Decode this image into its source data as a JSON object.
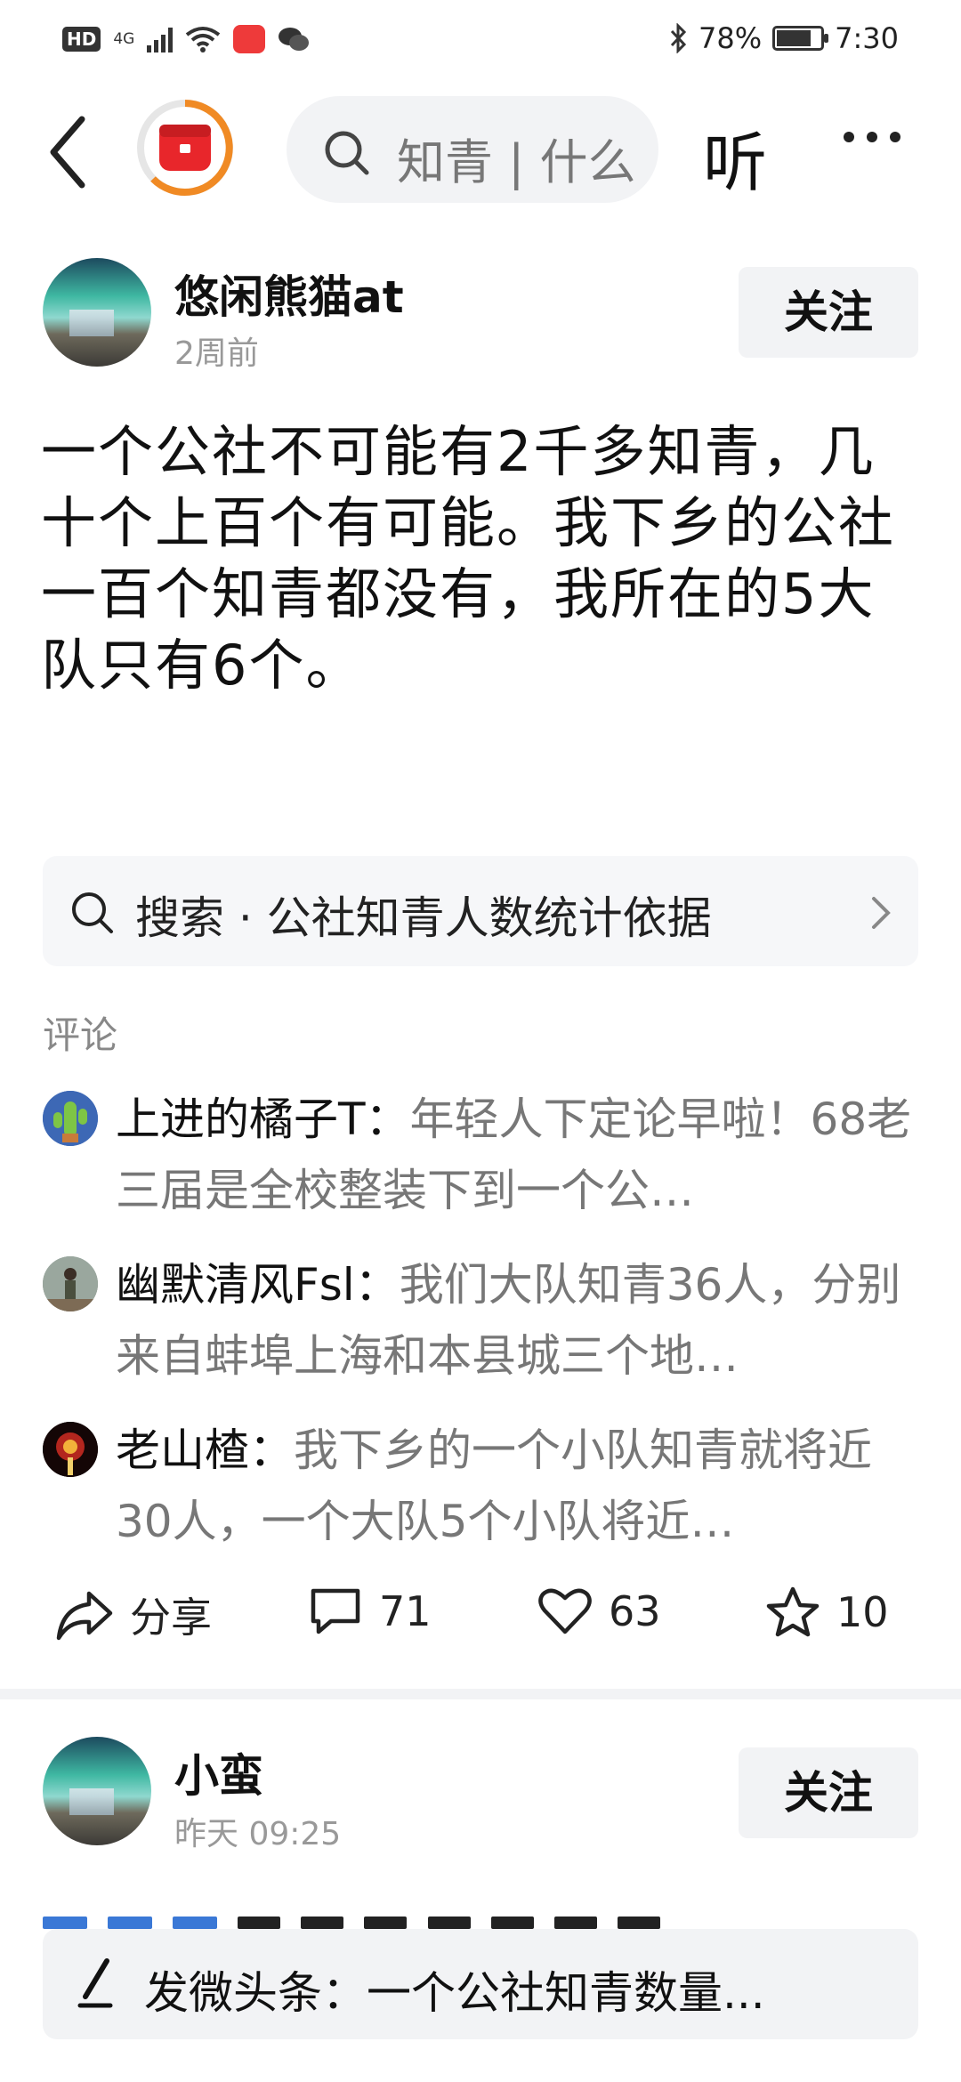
{
  "status_bar": {
    "hd": "HD",
    "network": "4G",
    "bluetooth_icon": "bluetooth-icon",
    "battery_percent": "78%",
    "battery_level": 0.78,
    "time": "7:30"
  },
  "header": {
    "search_placeholder": "知青 | 什么",
    "search_visible": "知青 | 什么",
    "listen_label": "听"
  },
  "posts": [
    {
      "author": "悠闲熊猫at",
      "time": "2周前",
      "follow_label": "关注",
      "body": "一个公社不可能有2千多知青，几十个上百个有可能。我下乡的公社一百个知青都没有，我所在的5大队只有6个。",
      "search_suggestion": "搜索 · 公社知青人数统计依据",
      "comments_title": "评论",
      "comments": [
        {
          "user": "上进的橘子T：",
          "text": "年轻人下定论早啦！68老三届是全校整装下到一个公…"
        },
        {
          "user": "幽默清风Fsl：",
          "text": "我们大队知青36人，分别来自蚌埠上海和本县城三个地…"
        },
        {
          "user": "老山楂：",
          "text": "我下乡的一个小队知青就将近30人，一个大队5个小队将近…"
        }
      ],
      "actions": {
        "share_label": "分享",
        "comment_count": "71",
        "like_count": "63",
        "favorite_count": "10"
      }
    },
    {
      "author": "小蛮",
      "time": "昨天  09:25",
      "follow_label": "关注"
    }
  ],
  "bottom_bar": {
    "compose_text": "发微头条：一个公社知青数量..."
  },
  "colors": {
    "accent_orange": "#f08a24",
    "app_red": "#e8262b",
    "muted_text": "#777777",
    "surface_gray": "#f2f3f5"
  }
}
